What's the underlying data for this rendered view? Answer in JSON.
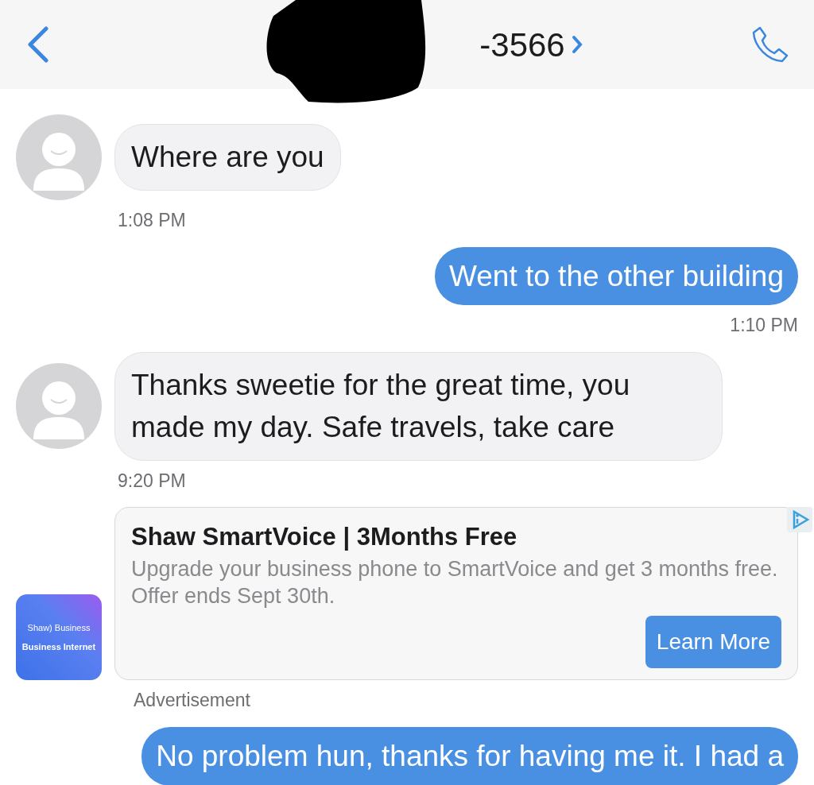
{
  "header": {
    "title": "-3566"
  },
  "messages": [
    {
      "kind": "received",
      "text": "Where are you",
      "time": "1:08 PM"
    },
    {
      "kind": "sent",
      "text": "Went to the other building",
      "time": "1:10 PM"
    },
    {
      "kind": "received",
      "text": "Thanks sweetie for the great time, you made my day. Safe travels, take care",
      "time": "9:20 PM"
    },
    {
      "kind": "ad",
      "logo_lines": [
        "Shaw) Business",
        "Business Internet"
      ],
      "title": "Shaw SmartVoice | 3Months Free",
      "body": "Upgrade your business phone to SmartVoice and get 3 months free. Offer ends Sept 30th.",
      "button": "Learn More",
      "label": "Advertisement"
    },
    {
      "kind": "sent",
      "text": "No problem hun, thanks for having me it. I had a"
    }
  ]
}
